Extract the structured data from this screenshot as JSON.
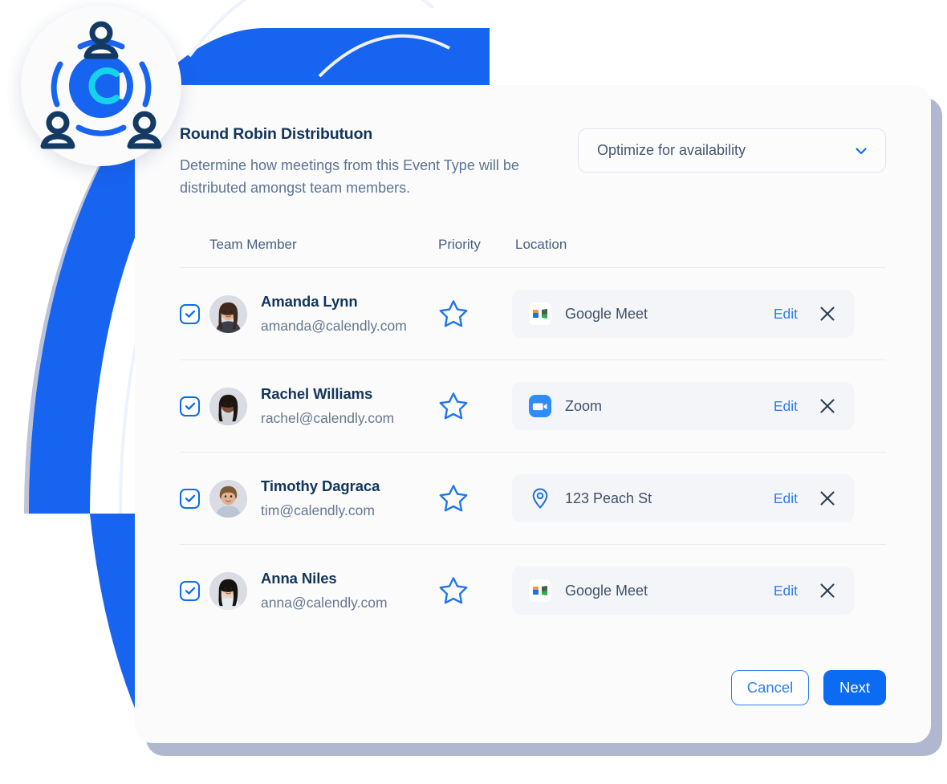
{
  "panel": {
    "title": "Round Robin Distributuon",
    "description": "Determine how meetings from this Event Type will be distributed amongst team members.",
    "distribution_select": {
      "value": "Optimize for availability",
      "icon": "chevron-down-icon"
    }
  },
  "table": {
    "headers": {
      "member": "Team Member",
      "priority": "Priority",
      "location": "Location"
    },
    "rows": [
      {
        "selected": true,
        "name": "Amanda Lynn",
        "email": "amanda@calendly.com",
        "priority_icon": "star-outline-icon",
        "location": {
          "icon": "google-meet-icon",
          "label": "Google Meet",
          "edit_label": "Edit",
          "remove_icon": "close-icon"
        }
      },
      {
        "selected": true,
        "name": "Rachel Williams",
        "email": "rachel@calendly.com",
        "priority_icon": "star-outline-icon",
        "location": {
          "icon": "zoom-icon",
          "label": "Zoom",
          "edit_label": "Edit",
          "remove_icon": "close-icon"
        }
      },
      {
        "selected": true,
        "name": "Timothy Dagraca",
        "email": "tim@calendly.com",
        "priority_icon": "star-outline-icon",
        "location": {
          "icon": "map-pin-icon",
          "label": "123 Peach St",
          "edit_label": "Edit",
          "remove_icon": "close-icon"
        }
      },
      {
        "selected": true,
        "name": "Anna Niles",
        "email": "anna@calendly.com",
        "priority_icon": "star-outline-icon",
        "location": {
          "icon": "google-meet-icon",
          "label": "Google Meet",
          "edit_label": "Edit",
          "remove_icon": "close-icon"
        }
      }
    ]
  },
  "footer": {
    "cancel_label": "Cancel",
    "next_label": "Next"
  },
  "logo": {
    "name": "round-robin-logo-icon"
  },
  "colors": {
    "brand_blue": "#0b6bf3",
    "link_blue": "#2f7ef0",
    "cyan_accent": "#16d2ea",
    "navy": "#12355b",
    "muted_text": "#5d7490",
    "card_bg": "#fbfbfc",
    "pill_bg": "#f4f5f8",
    "shadow": "#6e7daa"
  }
}
